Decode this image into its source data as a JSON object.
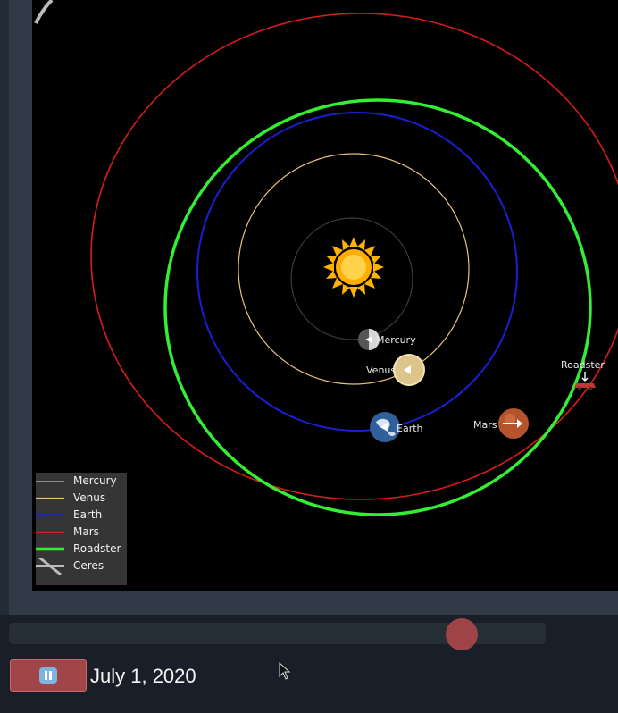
{
  "planets": [
    {
      "name": "Mercury",
      "label": "Mercury",
      "color": "#2e2e2e",
      "legend_color": "#8a8a8a"
    },
    {
      "name": "Venus",
      "label": "Venus",
      "color": "#e8c27a",
      "legend_color": "#e8c27a"
    },
    {
      "name": "Earth",
      "label": "Earth",
      "color": "#1a1fd6",
      "legend_color": "#1a1fd6"
    },
    {
      "name": "Mars",
      "label": "Mars",
      "color": "#d81c1c",
      "legend_color": "#d81c1c"
    },
    {
      "name": "Roadster",
      "label": "Roadster",
      "color": "#33ee33",
      "legend_color": "#33ee33"
    },
    {
      "name": "Ceres",
      "label": "Ceres",
      "color": "#bbbbbb",
      "legend_color": "#bbbbbb"
    }
  ],
  "legend": {
    "items": [
      "Mercury",
      "Venus",
      "Earth",
      "Mars",
      "Roadster",
      "Ceres"
    ]
  },
  "labels": {
    "mercury": "Mercury",
    "venus": "Venus",
    "earth": "Earth",
    "mars": "Mars",
    "roadster": "Roadster"
  },
  "controls": {
    "play_icon": "pause-icon",
    "date": "July 1, 2020",
    "slider_progress": 0.84
  }
}
